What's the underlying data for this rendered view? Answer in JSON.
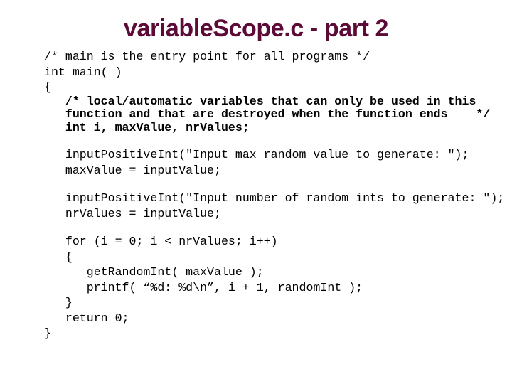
{
  "slide": {
    "title": "variableScope.c - part 2",
    "title_color": "#5c0a37",
    "background_color": "#ffffff",
    "text_color": "#000000"
  },
  "code": {
    "language": "c",
    "lines": [
      {
        "id": "l01",
        "text": "/* main is the entry point for all programs */",
        "bold": false
      },
      {
        "id": "l02",
        "text": "int main( )",
        "bold": false
      },
      {
        "id": "l03",
        "text": "{",
        "bold": false
      },
      {
        "id": "l04",
        "text": "   /* local/automatic variables that can only be used in this",
        "bold": true
      },
      {
        "id": "l05",
        "text": "   function and that are destroyed when the function ends    */",
        "bold": true
      },
      {
        "id": "l06",
        "text": "   int i, maxValue, nrValues;",
        "bold": true
      },
      {
        "id": "l07",
        "text": "",
        "bold": false
      },
      {
        "id": "l08",
        "text": "   inputPositiveInt(\"Input max random value to generate: \");",
        "bold": false
      },
      {
        "id": "l09",
        "text": "   maxValue = inputValue;",
        "bold": false
      },
      {
        "id": "l10",
        "text": "",
        "bold": false
      },
      {
        "id": "l11",
        "text": "   inputPositiveInt(\"Input number of random ints to generate: \");",
        "bold": false
      },
      {
        "id": "l12",
        "text": "   nrValues = inputValue;",
        "bold": false
      },
      {
        "id": "l13",
        "text": "",
        "bold": false
      },
      {
        "id": "l14",
        "text": "   for (i = 0; i < nrValues; i++)",
        "bold": false
      },
      {
        "id": "l15",
        "text": "   {",
        "bold": false
      },
      {
        "id": "l16",
        "text": "      getRandomInt( maxValue );",
        "bold": false
      },
      {
        "id": "l17",
        "text": "      printf( “%d: %d\\n”, i + 1, randomInt );",
        "bold": false
      },
      {
        "id": "l18",
        "text": "   }",
        "bold": false
      },
      {
        "id": "l19",
        "text": "   return 0;",
        "bold": false
      },
      {
        "id": "l20",
        "text": "}",
        "bold": false
      }
    ]
  }
}
